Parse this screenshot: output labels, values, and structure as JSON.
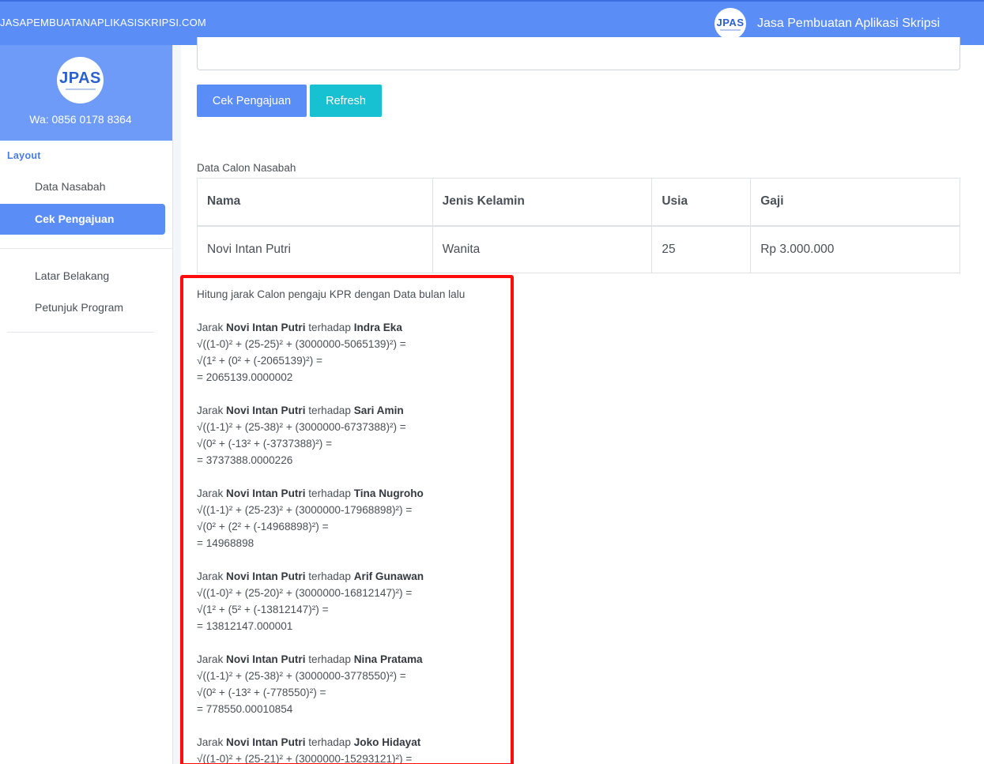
{
  "topbar": {
    "brand_url": "JASAPEMBUATANAPLIKASISKRIPSI.COM",
    "logo_text": "JPAS",
    "app_name": "Jasa Pembuatan Aplikasi Skripsi"
  },
  "sidebar": {
    "logo_text": "JPAS",
    "whatsapp": "Wa: 0856 0178 8364",
    "section_label": "Layout",
    "items": [
      {
        "label": "Data Nasabah",
        "active": false
      },
      {
        "label": "Cek Pengajuan",
        "active": true
      },
      {
        "label": "Latar Belakang",
        "active": false
      },
      {
        "label": "Petunjuk Program",
        "active": false
      }
    ]
  },
  "actions": {
    "check_label": "Cek Pengajuan",
    "refresh_label": "Refresh"
  },
  "table": {
    "caption": "Data Calon Nasabah",
    "headers": [
      "Nama",
      "Jenis Kelamin",
      "Usia",
      "Gaji"
    ],
    "rows": [
      [
        "Novi Intan Putri",
        "Wanita",
        "25",
        "Rp 3.000.000"
      ]
    ]
  },
  "calculation": {
    "intro": "Hitung jarak Calon pengaju KPR dengan Data bulan lalu",
    "subject": "Novi Intan Putri",
    "prefix": "Jarak",
    "connector": "terhadap",
    "entries": [
      {
        "target": "Indra Eka",
        "line1": "√((1-0)² + (25-25)² + (3000000-5065139)²) =",
        "line2": "√(1² + (0² + (-2065139)²) =",
        "result": "= 2065139.0000002"
      },
      {
        "target": "Sari Amin",
        "line1": "√((1-1)² + (25-38)² + (3000000-6737388)²) =",
        "line2": "√(0² + (-13² + (-3737388)²) =",
        "result": "= 3737388.0000226"
      },
      {
        "target": "Tina Nugroho",
        "line1": "√((1-1)² + (25-23)² + (3000000-17968898)²) =",
        "line2": "√(0² + (2² + (-14968898)²) =",
        "result": "= 14968898"
      },
      {
        "target": "Arif Gunawan",
        "line1": "√((1-0)² + (25-20)² + (3000000-16812147)²) =",
        "line2": "√(1² + (5² + (-13812147)²) =",
        "result": "= 13812147.000001"
      },
      {
        "target": "Nina Pratama",
        "line1": "√((1-1)² + (25-38)² + (3000000-3778550)²) =",
        "line2": "√(0² + (-13² + (-778550)²) =",
        "result": "= 778550.00010854"
      },
      {
        "target": "Joko Hidayat",
        "line1": "√((1-0)² + (25-21)² + (3000000-15293121)²) =",
        "line2": "",
        "result": ""
      }
    ]
  },
  "colors": {
    "primary": "#5b8df7",
    "info": "#17c1d1",
    "highlight": "#ff0d0d"
  }
}
